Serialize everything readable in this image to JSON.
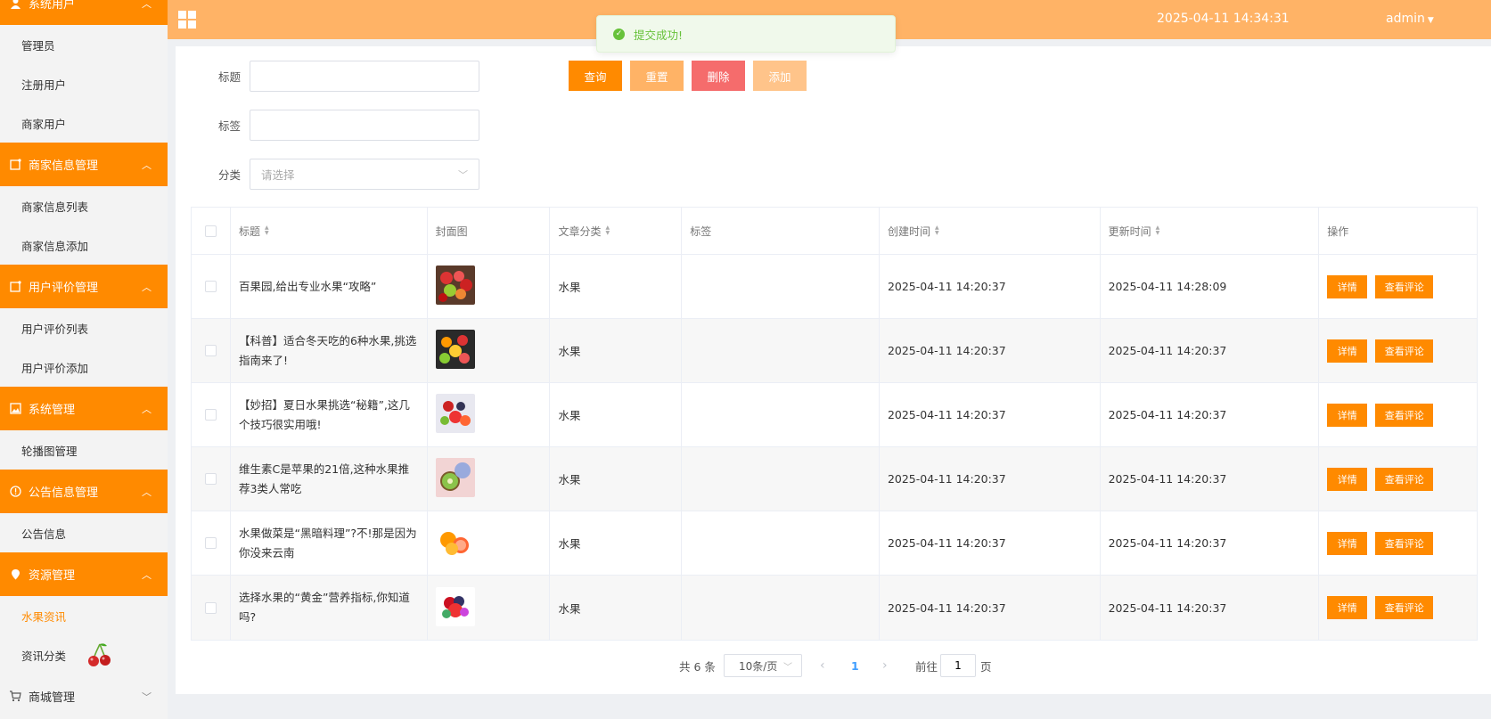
{
  "sidebar": {
    "groups": [
      {
        "label": "系统用户",
        "items": [
          "管理员",
          "注册用户",
          "商家用户"
        ]
      },
      {
        "label": "商家信息管理",
        "items": [
          "商家信息列表",
          "商家信息添加"
        ]
      },
      {
        "label": "用户评价管理",
        "items": [
          "用户评价列表",
          "用户评价添加"
        ]
      },
      {
        "label": "系统管理",
        "items": [
          "轮播图管理"
        ]
      },
      {
        "label": "公告信息管理",
        "items": [
          "公告信息"
        ]
      },
      {
        "label": "资源管理",
        "items": [
          "水果资讯",
          "资讯分类"
        ]
      },
      {
        "label": "商城管理",
        "items": []
      }
    ],
    "active_item": "水果资讯"
  },
  "header": {
    "datetime": "2025-04-11 14:34:31",
    "user": "admin"
  },
  "toast": {
    "message": "提交成功!"
  },
  "search": {
    "title_label": "标题",
    "title_value": "",
    "tag_label": "标签",
    "tag_value": "",
    "category_label": "分类",
    "category_placeholder": "请选择",
    "query_button": "查询",
    "reset_button": "重置",
    "delete_button": "删除",
    "add_button": "添加"
  },
  "colors": {
    "accent": "#ff8a00",
    "header": "#ffb366",
    "delete": "#f56c6c",
    "success": "#67c23a"
  },
  "table": {
    "headers": [
      "标题",
      "封面图",
      "文章分类",
      "标签",
      "创建时间",
      "更新时间",
      "操作"
    ],
    "rows": [
      {
        "title": "百果园,给出专业水果“攻略”",
        "category": "水果",
        "tag": "",
        "created": "2025-04-11 14:20:37",
        "updated": "2025-04-11 14:28:09",
        "thumb": "mixed-fruit-basket"
      },
      {
        "title": "【科普】适合冬天吃的6种水果,挑选指南来了!",
        "category": "水果",
        "tag": "",
        "created": "2025-04-11 14:20:37",
        "updated": "2025-04-11 14:20:37",
        "thumb": "winter-fruits"
      },
      {
        "title": "【妙招】夏日水果挑选“秘籍”,这几个技巧很实用哦!",
        "category": "水果",
        "tag": "",
        "created": "2025-04-11 14:20:37",
        "updated": "2025-04-11 14:20:37",
        "thumb": "summer-fruits"
      },
      {
        "title": "维生素C是苹果的21倍,这种水果推荐3类人常吃",
        "category": "水果",
        "tag": "",
        "created": "2025-04-11 14:20:37",
        "updated": "2025-04-11 14:20:37",
        "thumb": "kiwi"
      },
      {
        "title": "水果做菜是“黑暗料理”?不!那是因为你没来云南",
        "category": "水果",
        "tag": "",
        "created": "2025-04-11 14:20:37",
        "updated": "2025-04-11 14:20:37",
        "thumb": "citrus"
      },
      {
        "title": "选择水果的“黄金”营养指标,你知道吗?",
        "category": "水果",
        "tag": "",
        "created": "2025-04-11 14:20:37",
        "updated": "2025-04-11 14:20:37",
        "thumb": "berries"
      }
    ],
    "detail_label": "详情",
    "comments_label": "查看评论"
  },
  "pagination": {
    "total": "共 6 条",
    "page_size": "10条/页",
    "current_page": "1",
    "goto_label": "前往",
    "goto_value": "1",
    "page_unit": "页"
  }
}
